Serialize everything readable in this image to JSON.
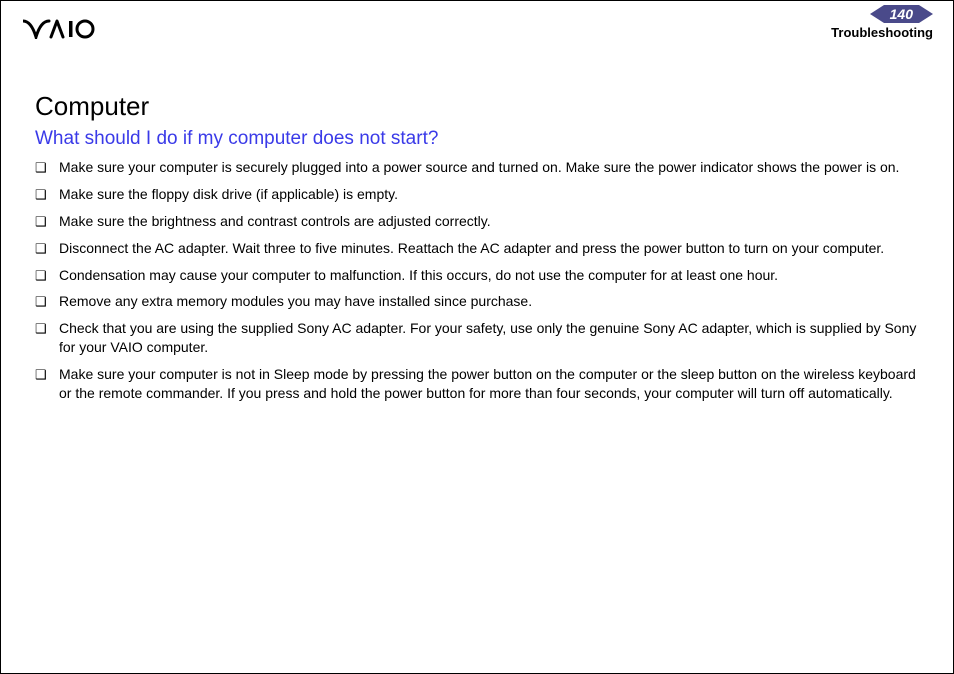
{
  "header": {
    "page_number": "140",
    "section": "Troubleshooting",
    "logo_alt": "VAIO"
  },
  "main": {
    "title": "Computer",
    "question": "What should I do if my computer does not start?",
    "bullets": [
      "Make sure your computer is securely plugged into a power source and turned on. Make sure the power indicator shows the power is on.",
      "Make sure the floppy disk drive (if applicable) is empty.",
      "Make sure the brightness and contrast controls are adjusted correctly.",
      "Disconnect the AC adapter. Wait three to five minutes. Reattach the AC adapter and press the power button to turn on your computer.",
      "Condensation may cause your computer to malfunction. If this occurs, do not use the computer for at least one hour.",
      "Remove any extra memory modules you may have installed since purchase.",
      "Check that you are using the supplied Sony AC adapter. For your safety, use only the genuine Sony AC adapter, which is supplied by Sony for your VAIO computer.",
      "Make sure your computer is not in Sleep mode by pressing the power button on the computer or the sleep button on the wireless keyboard or the remote commander. If you press and hold the power button for more than four seconds, your computer will turn off automatically."
    ]
  }
}
